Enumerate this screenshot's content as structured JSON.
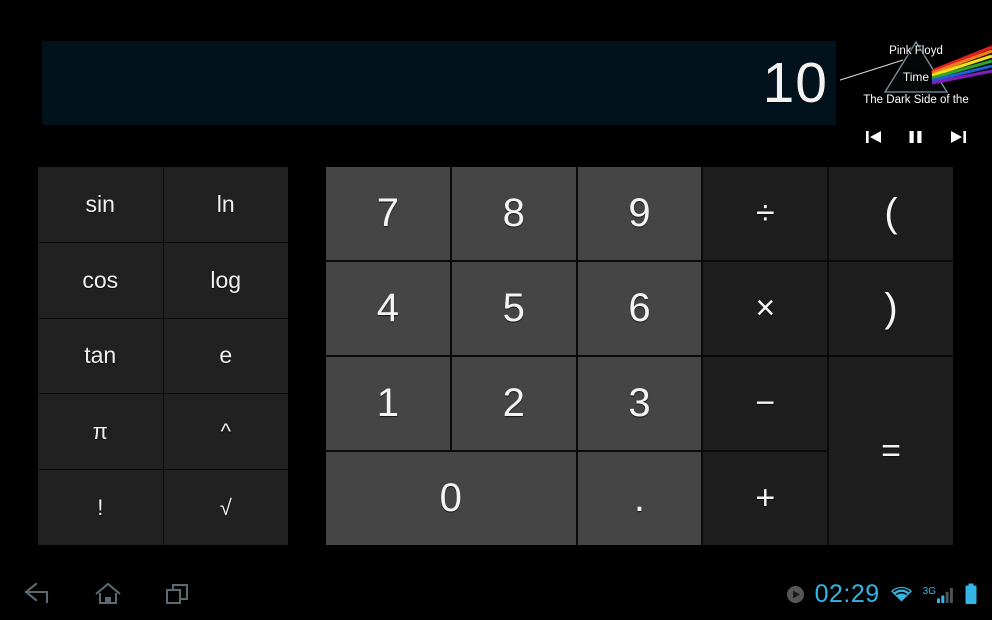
{
  "display": {
    "value": "10"
  },
  "now_playing": {
    "artist": "Pink Floyd",
    "track": "Time",
    "album": "The Dark Side of the",
    "album_art_name": "dark-side-of-the-moon-prism",
    "controls": {
      "previous_label": "Previous track",
      "pause_label": "Pause",
      "next_label": "Next track"
    }
  },
  "function_pad": {
    "keys": [
      {
        "label": "sin",
        "name": "sin-key"
      },
      {
        "label": "ln",
        "name": "ln-key"
      },
      {
        "label": "cos",
        "name": "cos-key"
      },
      {
        "label": "log",
        "name": "log-key"
      },
      {
        "label": "tan",
        "name": "tan-key"
      },
      {
        "label": "e",
        "name": "e-key"
      },
      {
        "label": "π",
        "name": "pi-key"
      },
      {
        "label": "^",
        "name": "power-key"
      },
      {
        "label": "!",
        "name": "factorial-key"
      },
      {
        "label": "√",
        "name": "sqrt-key"
      }
    ]
  },
  "keypad": {
    "seven": "7",
    "eight": "8",
    "nine": "9",
    "divide": "÷",
    "open_paren": "(",
    "four": "4",
    "five": "5",
    "six": "6",
    "multiply": "×",
    "close_paren": ")",
    "one": "1",
    "two": "2",
    "three": "3",
    "minus": "−",
    "zero": "0",
    "decimal": ".",
    "plus": "+",
    "equals": "="
  },
  "system_bar": {
    "back_label": "Back",
    "home_label": "Home",
    "recents_label": "Recent apps",
    "clock": "02:29",
    "network_type": "3G",
    "media_playing_label": "Media playing",
    "wifi_label": "Wi-Fi connected",
    "battery_label": "Battery full"
  },
  "colors": {
    "accent": "#33b5e5",
    "display_bg": "#02121d",
    "number_key": "#454545",
    "operator_key": "#1e1e1e",
    "function_key": "#212121"
  }
}
